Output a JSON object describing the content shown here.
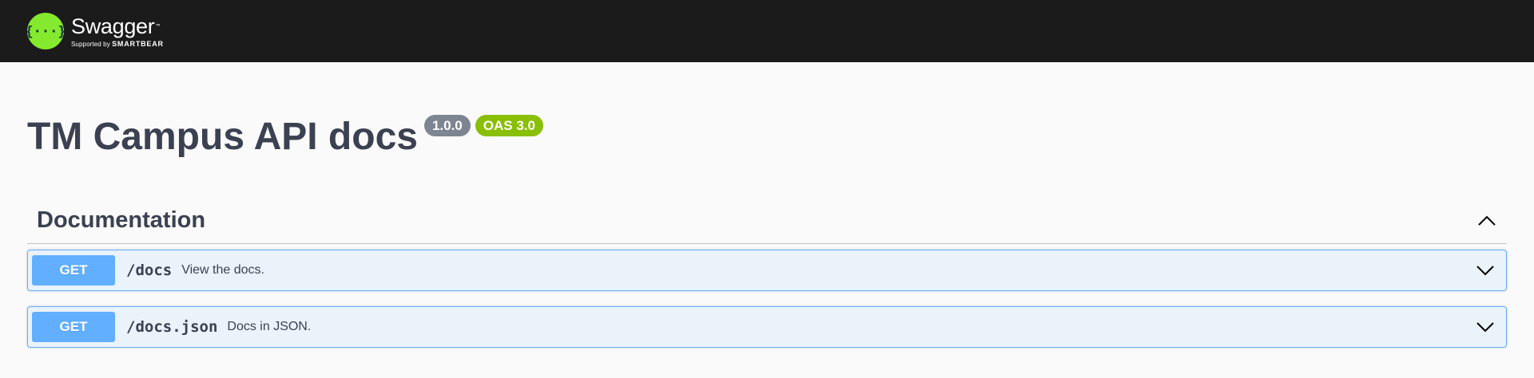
{
  "topbar": {
    "logo_name": "Swagger",
    "logo_tm": "™",
    "logo_supported": "Supported by",
    "logo_brand": "SMARTBEAR",
    "logo_icon": "swagger-logo-icon",
    "colors": {
      "background": "#1b1b1b",
      "logo": "#85ea2d"
    }
  },
  "info": {
    "title": "TM Campus API docs",
    "version": "1.0.0",
    "oas": "OAS 3.0"
  },
  "tag": {
    "name": "Documentation",
    "collapse_icon": "chevron-up-icon"
  },
  "operations": [
    {
      "method": "GET",
      "path": "/docs",
      "summary": "View the docs.",
      "expand_icon": "chevron-down-icon"
    },
    {
      "method": "GET",
      "path": "/docs.json",
      "summary": "Docs in JSON.",
      "expand_icon": "chevron-down-icon"
    }
  ],
  "colors": {
    "get": "#61affe",
    "oas_badge": "#89bf04",
    "version_badge": "#7d8492",
    "text": "#3b4151"
  }
}
